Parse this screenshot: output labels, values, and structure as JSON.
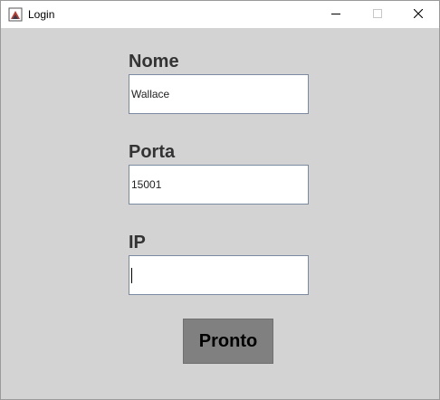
{
  "window": {
    "title": "Login",
    "controls": {
      "minimize_icon": "minimize-icon",
      "maximize_icon": "maximize-icon",
      "close_icon": "close-icon"
    }
  },
  "form": {
    "name_label": "Nome",
    "name_value": "Wallace",
    "port_label": "Porta",
    "port_value": "15001",
    "ip_label": "IP",
    "ip_value": "",
    "submit_label": "Pronto"
  },
  "colors": {
    "background": "#d3d3d3",
    "button": "#808080",
    "label": "#333333"
  }
}
